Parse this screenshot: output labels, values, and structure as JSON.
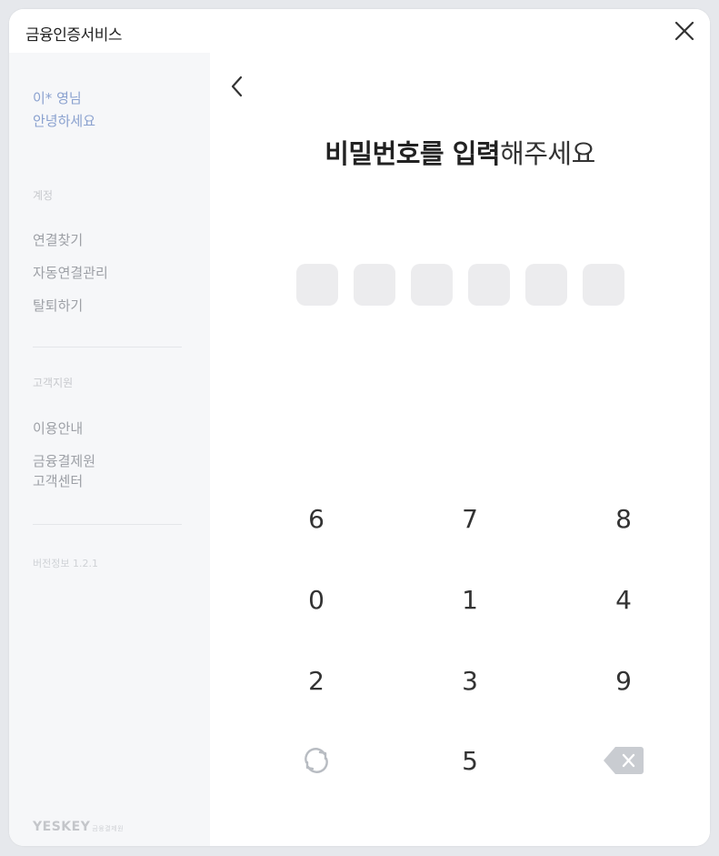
{
  "window": {
    "title": "금융인증서비스"
  },
  "sidebar": {
    "greeting_line1": "이* 영님",
    "greeting_line2": "안녕하세요",
    "account_section_label": "계정",
    "account_items": [
      "연결찾기",
      "자동연결관리",
      "탈퇴하기"
    ],
    "support_section_label": "고객지원",
    "support_items": [
      "이용안내",
      "금융결제원",
      "고객센터"
    ],
    "version": "버전정보 1.2.1",
    "brand": "YESKEY",
    "brand_sub": "금융결제원"
  },
  "main": {
    "heading_bold_1": "비밀번호를 입력",
    "heading_normal": "해주세요",
    "pin_length": 6,
    "keypad": {
      "rows": [
        [
          "6",
          "7",
          "8"
        ],
        [
          "0",
          "1",
          "4"
        ],
        [
          "2",
          "3",
          "9"
        ]
      ],
      "bottom_center": "5"
    }
  },
  "icons": {
    "close": "close-icon",
    "back": "chevron-left-icon",
    "shuffle": "refresh-icon",
    "backspace": "backspace-icon"
  },
  "colors": {
    "accent_greeting": "#8aa1cf",
    "pin_box": "#ececee",
    "sidebar_bg": "#f6f7f9"
  }
}
